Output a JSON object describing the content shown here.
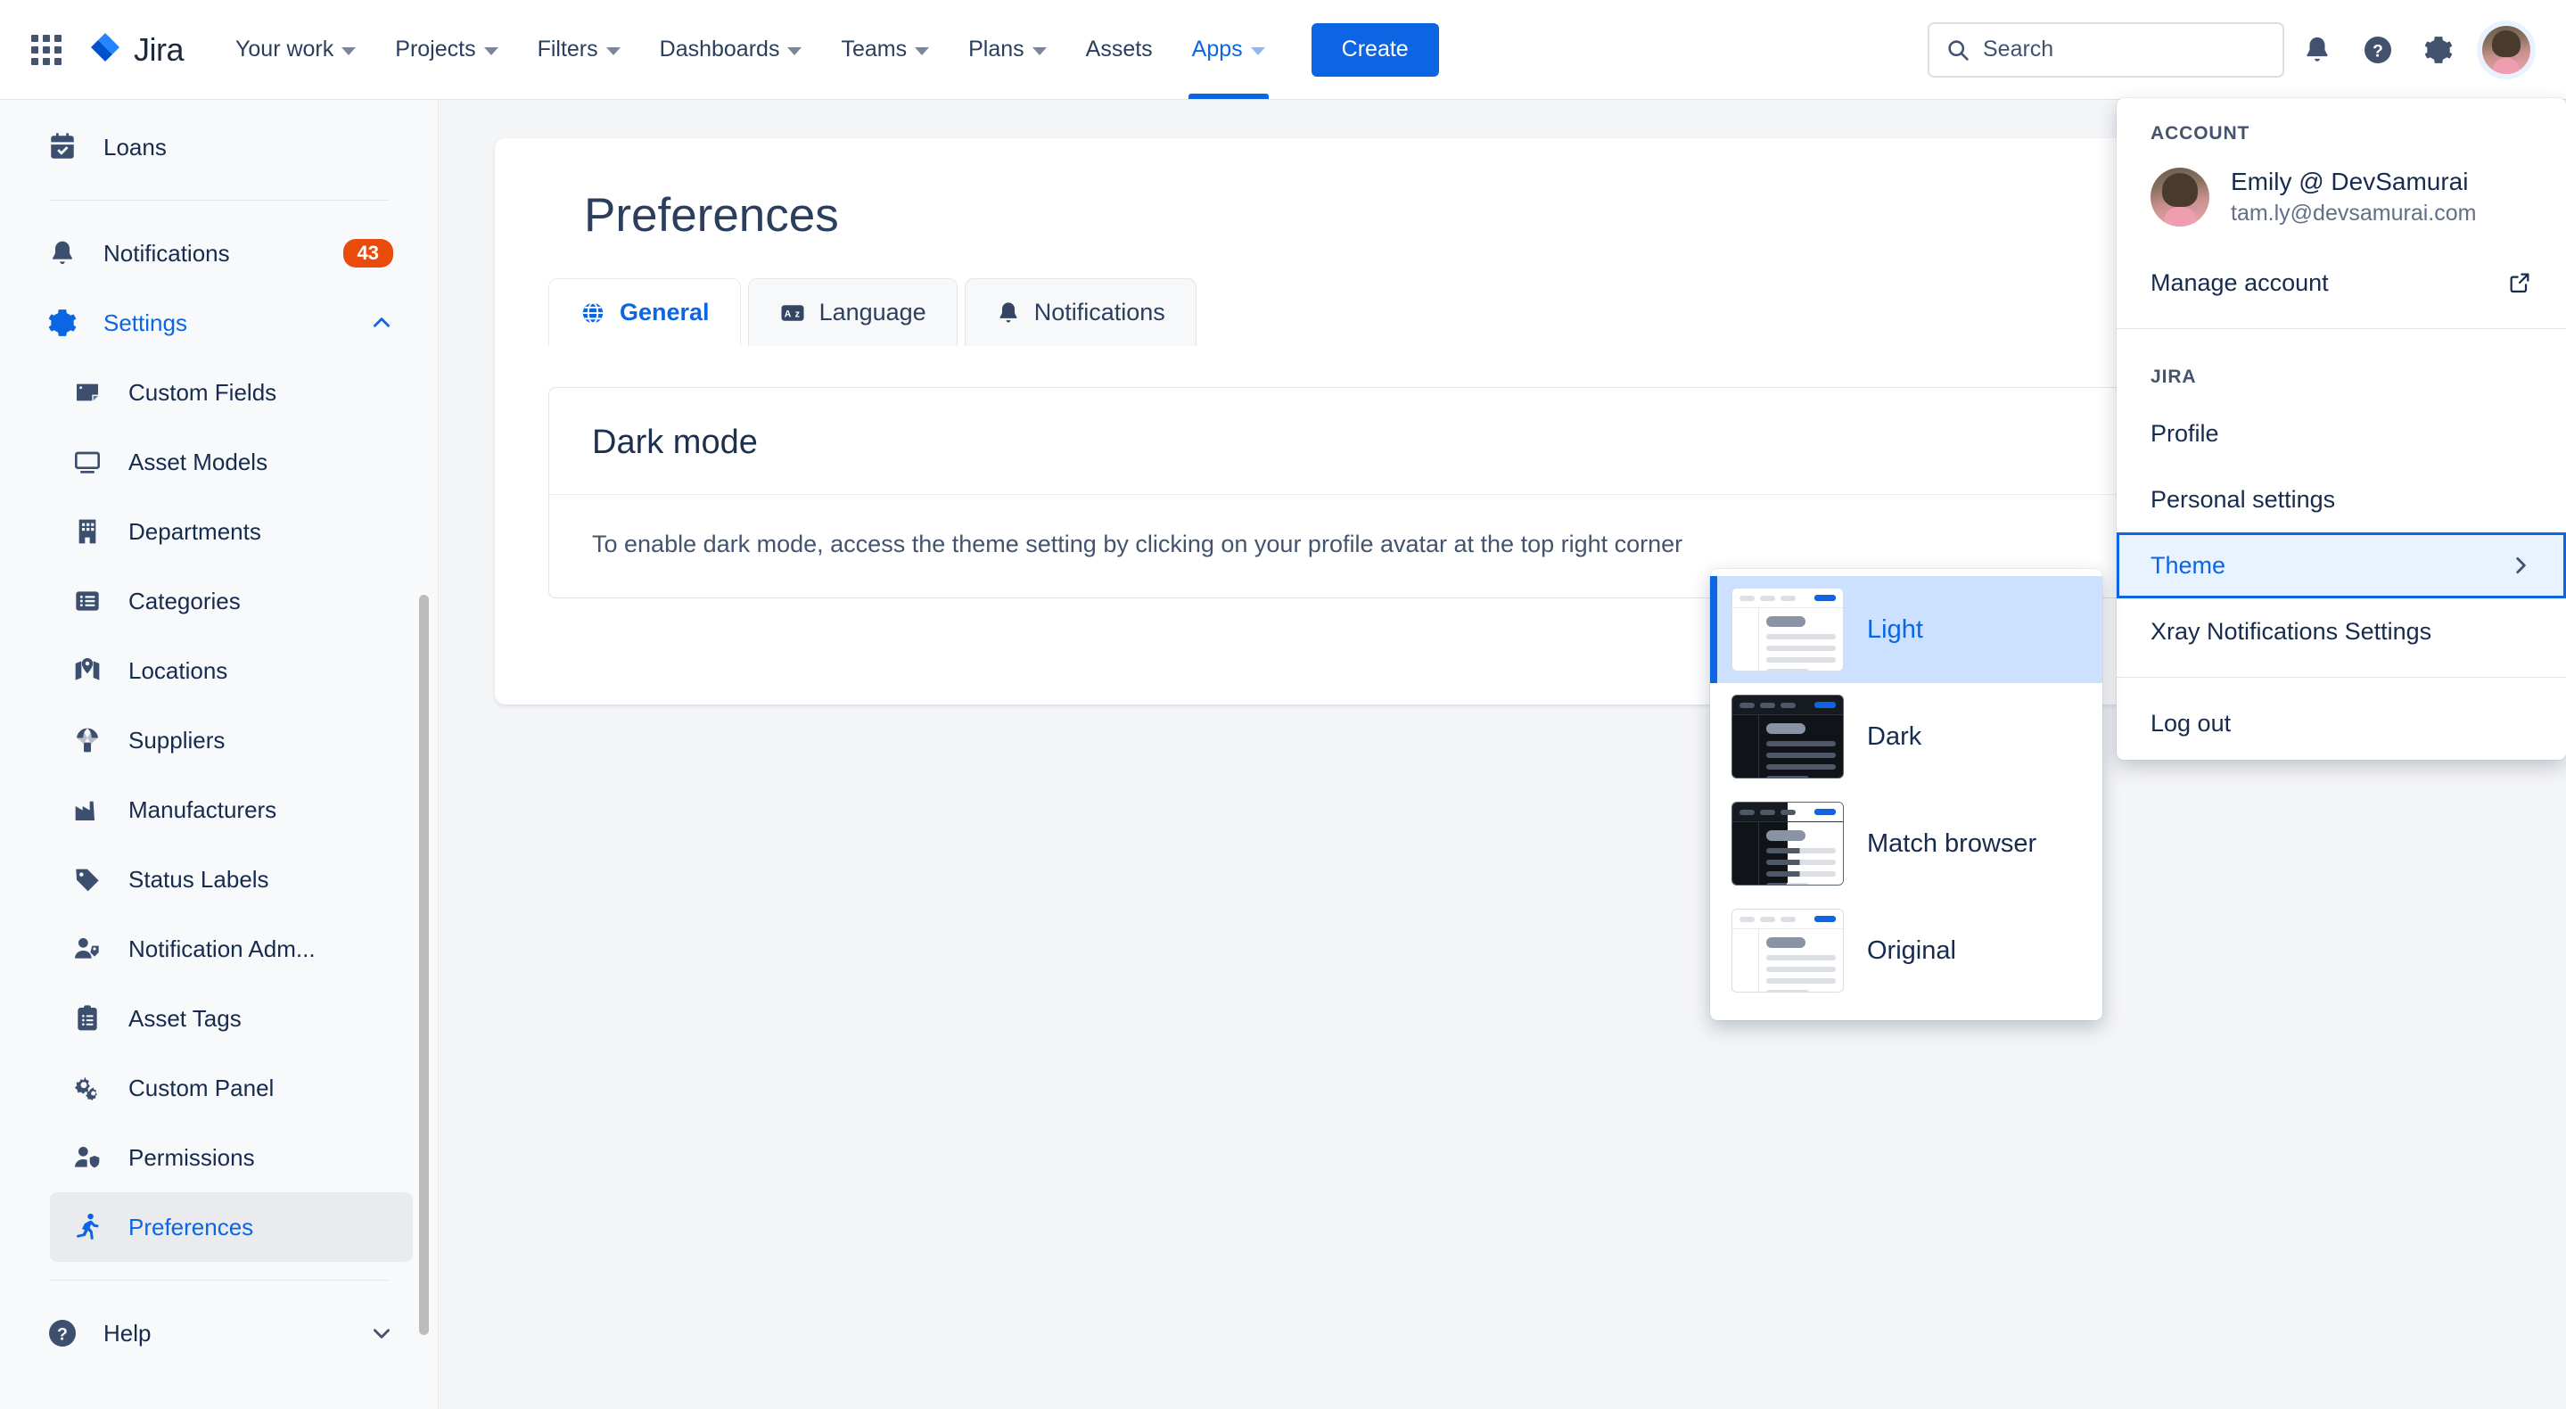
{
  "topnav": {
    "brand": "Jira",
    "app_switcher_icon": "grid-apps-icon",
    "items": [
      {
        "label": "Your work",
        "has_caret": true,
        "active": false
      },
      {
        "label": "Projects",
        "has_caret": true,
        "active": false
      },
      {
        "label": "Filters",
        "has_caret": true,
        "active": false
      },
      {
        "label": "Dashboards",
        "has_caret": true,
        "active": false
      },
      {
        "label": "Teams",
        "has_caret": true,
        "active": false
      },
      {
        "label": "Plans",
        "has_caret": true,
        "active": false
      },
      {
        "label": "Assets",
        "has_caret": false,
        "active": false
      },
      {
        "label": "Apps",
        "has_caret": true,
        "active": true
      }
    ],
    "create_label": "Create",
    "search_placeholder": "Search",
    "icons": [
      "search-icon",
      "notifications-icon",
      "help-icon",
      "settings-gear-icon",
      "avatar"
    ]
  },
  "sidebar": {
    "items": [
      {
        "label": "Loans",
        "icon": "calendar-check-icon",
        "level": "top",
        "selected": false
      },
      {
        "label": "Notifications",
        "icon": "bell-icon",
        "level": "top",
        "selected": false,
        "badge": "43"
      },
      {
        "label": "Settings",
        "icon": "gear-icon",
        "level": "top",
        "selected": false,
        "blue": true,
        "chevron": "chevron-up-icon"
      },
      {
        "label": "Custom Fields",
        "icon": "custom-fields-icon",
        "level": "sub",
        "selected": false
      },
      {
        "label": "Asset Models",
        "icon": "monitor-icon",
        "level": "sub",
        "selected": false
      },
      {
        "label": "Departments",
        "icon": "building-icon",
        "level": "sub",
        "selected": false
      },
      {
        "label": "Categories",
        "icon": "list-icon",
        "level": "sub",
        "selected": false
      },
      {
        "label": "Locations",
        "icon": "map-pin-icon",
        "level": "sub",
        "selected": false
      },
      {
        "label": "Suppliers",
        "icon": "parachute-box-icon",
        "level": "sub",
        "selected": false
      },
      {
        "label": "Manufacturers",
        "icon": "factory-icon",
        "level": "sub",
        "selected": false
      },
      {
        "label": "Status Labels",
        "icon": "tag-icon",
        "level": "sub",
        "selected": false
      },
      {
        "label": "Notification Adm...",
        "icon": "user-tag-icon",
        "level": "sub",
        "selected": false
      },
      {
        "label": "Asset Tags",
        "icon": "clipboard-list-icon",
        "level": "sub",
        "selected": false
      },
      {
        "label": "Custom Panel",
        "icon": "gears-icon",
        "level": "sub",
        "selected": false
      },
      {
        "label": "Permissions",
        "icon": "user-shield-icon",
        "level": "sub",
        "selected": false
      },
      {
        "label": "Preferences",
        "icon": "running-person-icon",
        "level": "sub",
        "selected": true
      }
    ],
    "help": {
      "label": "Help",
      "icon": "help-circle-icon",
      "chevron": "chevron-down-icon"
    }
  },
  "main": {
    "page_title": "Preferences",
    "tabs": [
      {
        "label": "General",
        "icon": "globe-icon",
        "active": true
      },
      {
        "label": "Language",
        "icon": "translate-icon",
        "active": false
      },
      {
        "label": "Notifications",
        "icon": "bell-icon",
        "active": false
      }
    ],
    "dark_mode_card": {
      "title": "Dark mode",
      "body": "To enable dark mode, access the theme setting by clicking on your profile avatar at the top right corner"
    }
  },
  "profile_menu": {
    "account_label": "ACCOUNT",
    "user_name": "Emily @ DevSamurai",
    "user_email": "tam.ly@devsamurai.com",
    "manage_account": "Manage account",
    "manage_account_icon": "external-link-icon",
    "jira_label": "JIRA",
    "rows": [
      {
        "label": "Profile",
        "highlight": false
      },
      {
        "label": "Personal settings",
        "highlight": false
      },
      {
        "label": "Theme",
        "highlight": true,
        "chevron": "chevron-right-icon"
      },
      {
        "label": "Xray Notifications Settings",
        "highlight": false
      }
    ],
    "log_out": "Log out"
  },
  "theme_menu": {
    "options": [
      {
        "label": "Light",
        "preview": "light-theme-preview",
        "selected": true
      },
      {
        "label": "Dark",
        "preview": "dark-theme-preview",
        "selected": false
      },
      {
        "label": "Match browser",
        "preview": "split-theme-preview",
        "selected": false
      },
      {
        "label": "Original",
        "preview": "light-theme-preview",
        "selected": false
      }
    ]
  },
  "colors": {
    "brand_blue": "#0c66e4",
    "badge_red": "#e94b0c",
    "text_dark": "#172b4d",
    "page_bg": "#f4f5f7",
    "sidebar_bg": "#f8f9fb",
    "highlight_bg": "#e9f2ff",
    "theme_selected_bg": "#cce0ff"
  }
}
